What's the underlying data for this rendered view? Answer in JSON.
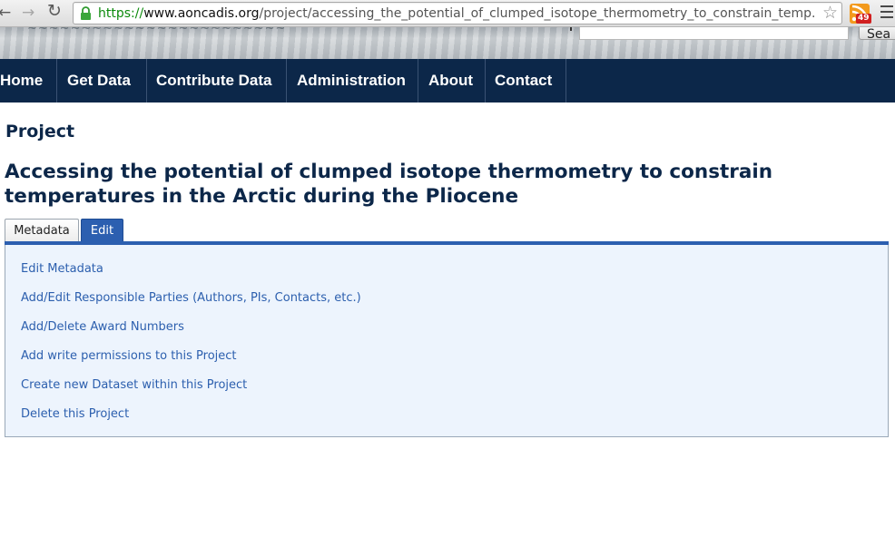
{
  "browser": {
    "url_scheme": "https://",
    "url_host": "www.aoncadis.org",
    "url_path": "/project/accessing_the_potential_of_clumped_isotope_thermometry_to_constrain_temp...",
    "rss_badge": "49"
  },
  "header": {
    "search_button": "Sea"
  },
  "nav": {
    "items": [
      {
        "label": "Home"
      },
      {
        "label": "Get Data"
      },
      {
        "label": "Contribute Data"
      },
      {
        "label": "Administration"
      },
      {
        "label": "About"
      },
      {
        "label": "Contact"
      }
    ]
  },
  "page": {
    "section_label": "Project",
    "title": "Accessing the potential of clumped isotope thermometry to constrain temperatures in the Arctic during the Pliocene",
    "tabs": [
      {
        "label": "Metadata",
        "active": false
      },
      {
        "label": "Edit",
        "active": true
      }
    ],
    "edit_links": [
      "Edit Metadata",
      "Add/Edit Responsible Parties (Authors, PIs, Contacts, etc.)",
      "Add/Delete Award Numbers",
      "Add write permissions to this Project",
      "Create new Dataset within this Project",
      "Delete this Project"
    ]
  },
  "colors": {
    "nav_background": "#0c2749",
    "title_color": "#0c2749",
    "active_tab": "#2c5fb0",
    "link_color": "#2c5fae",
    "panel_background": "#edf4fd"
  }
}
